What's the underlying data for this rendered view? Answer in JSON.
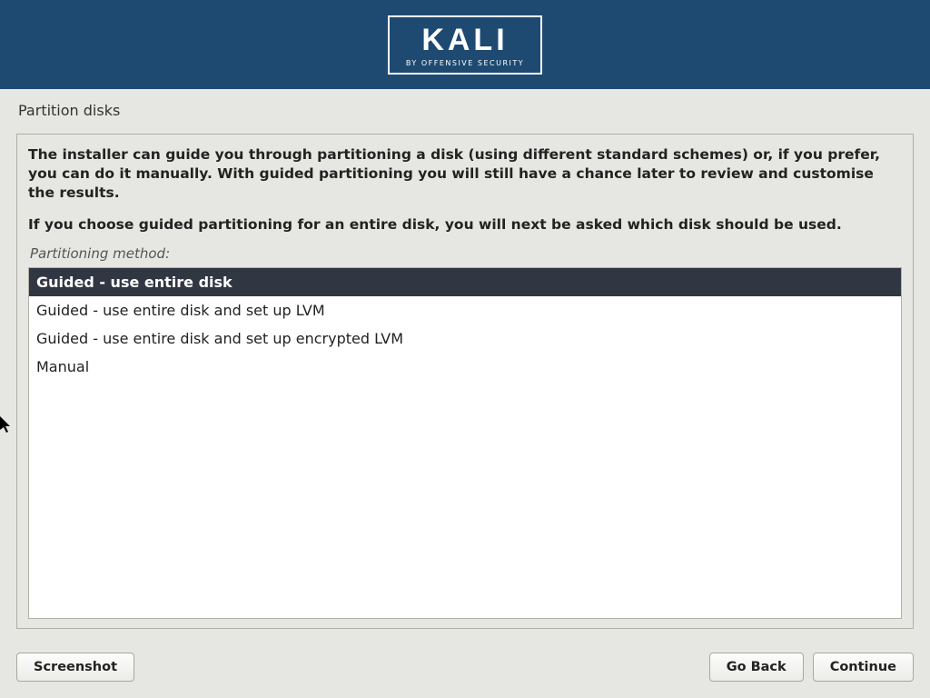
{
  "header": {
    "logo_text": "KALI",
    "logo_sub": "BY OFFENSIVE SECURITY"
  },
  "page": {
    "title": "Partition disks"
  },
  "main": {
    "description": "The installer can guide you through partitioning a disk (using different standard schemes) or, if you prefer, you can do it manually. With guided partitioning you will still have a chance later to review and customise the results.",
    "description2": "If you choose guided partitioning for an entire disk, you will next be asked which disk should be used.",
    "field_label": "Partitioning method:",
    "options": [
      {
        "label": "Guided - use entire disk",
        "selected": true
      },
      {
        "label": "Guided - use entire disk and set up LVM",
        "selected": false
      },
      {
        "label": "Guided - use entire disk and set up encrypted LVM",
        "selected": false
      },
      {
        "label": "Manual",
        "selected": false
      }
    ]
  },
  "buttons": {
    "screenshot": "Screenshot",
    "go_back": "Go Back",
    "continue": "Continue"
  }
}
